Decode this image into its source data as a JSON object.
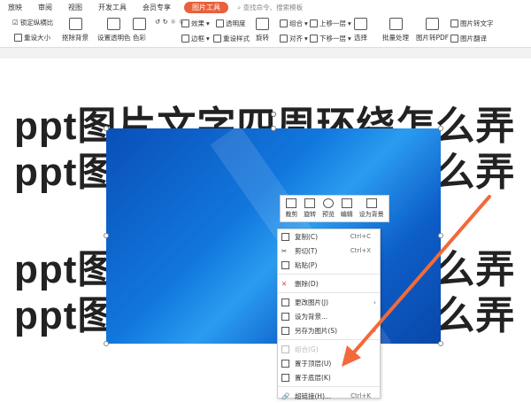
{
  "tabs": [
    "放映",
    "审阅",
    "视图",
    "开发工具",
    "会员专享",
    "图片工具"
  ],
  "search_placeholder": "查找命令、搜索模板",
  "ribbon": {
    "lock_ratio": "锁定纵横比",
    "reset_size": "重设大小",
    "remove_bg": "抠除背景",
    "set_transparent": "设置透明色",
    "color": "色彩",
    "effect": "效果",
    "transparency": "透明度",
    "border": "边框",
    "reset_style": "重设样式",
    "rotate": "旋转",
    "group": "组合",
    "align": "对齐",
    "bring_forward": "上移一层",
    "send_backward": "下移一层",
    "select": "选择",
    "batch": "批量处理",
    "to_pdf": "图片转PDF",
    "to_text": "图片转文字",
    "translate": "图片翻译"
  },
  "slide_lines": [
    "ppt图片文字四周环绕怎么弄",
    "ppt图片文字四周环绕怎么弄",
    "ppt图片文字四周环绕怎么弄",
    "ppt图片文字四周环绕怎么弄"
  ],
  "mini_toolbar": [
    "裁剪",
    "旋转",
    "预览",
    "编辑",
    "设为背景"
  ],
  "menu": [
    {
      "label": "复制(C)",
      "shortcut": "Ctrl+C"
    },
    {
      "label": "剪切(T)",
      "shortcut": "Ctrl+X"
    },
    {
      "label": "粘贴(P)",
      "shortcut": ""
    },
    {
      "label": "删除(D)",
      "shortcut": ""
    },
    {
      "label": "更改图片(J)",
      "shortcut": ""
    },
    {
      "label": "设为背景...",
      "shortcut": ""
    },
    {
      "label": "另存为图片(S)",
      "shortcut": ""
    },
    {
      "label": "组合(G)",
      "shortcut": ""
    },
    {
      "label": "置于顶层(U)",
      "shortcut": ""
    },
    {
      "label": "置于底层(K)",
      "shortcut": ""
    },
    {
      "label": "超链接(H)...",
      "shortcut": "Ctrl+K"
    }
  ],
  "colors": {
    "accent": "#e8613c",
    "arrow": "#f26a3a"
  }
}
